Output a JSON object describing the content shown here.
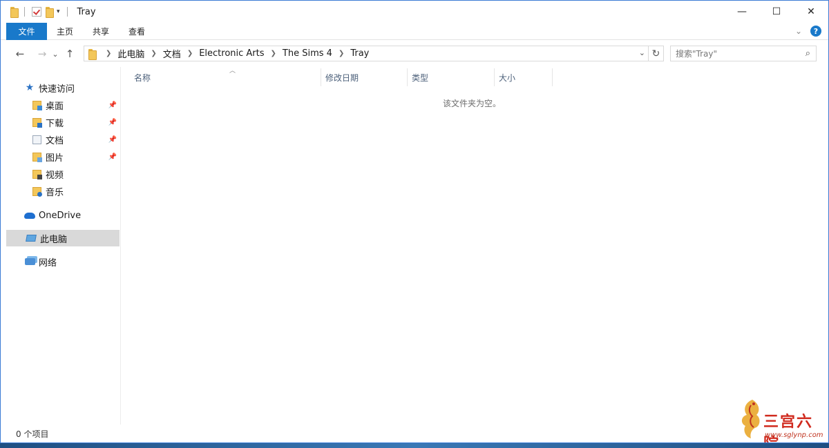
{
  "window": {
    "title": "Tray",
    "controls": {
      "minimize": "—",
      "maximize": "☐",
      "close": "✕"
    }
  },
  "ribbon": {
    "tabs": [
      "文件",
      "主页",
      "共享",
      "查看"
    ],
    "expand_icon": "chevron-down-icon",
    "help_label": "?"
  },
  "nav": {
    "back": "←",
    "forward": "→",
    "recent": "⌄",
    "up": "↑",
    "breadcrumb": [
      "此电脑",
      "文档",
      "Electronic Arts",
      "The Sims 4",
      "Tray"
    ],
    "search_placeholder": "搜索\"Tray\""
  },
  "sidebar": {
    "quick_access": "快速访问",
    "pinned": [
      {
        "label": "桌面"
      },
      {
        "label": "下载"
      },
      {
        "label": "文档"
      },
      {
        "label": "图片"
      },
      {
        "label": "视频"
      },
      {
        "label": "音乐"
      }
    ],
    "onedrive": "OneDrive",
    "this_pc": "此电脑",
    "network": "网络"
  },
  "columns": [
    "名称",
    "修改日期",
    "类型",
    "大小"
  ],
  "content": {
    "empty_message": "该文件夹为空。"
  },
  "status": {
    "item_count": "0 个项目"
  },
  "watermark": {
    "text": "三宫六院",
    "url": "www.sglynp.com"
  },
  "colors": {
    "accent": "#1979ca",
    "selection": "#d9d9d9",
    "folder": "#f3c75a"
  }
}
